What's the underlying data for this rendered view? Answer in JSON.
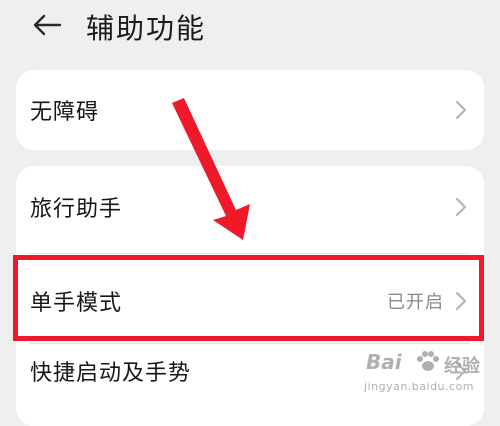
{
  "header": {
    "title": "辅助功能"
  },
  "menu": {
    "items": [
      {
        "label": "无障碍",
        "value": ""
      },
      {
        "label": "旅行助手",
        "value": ""
      },
      {
        "label": "单手模式",
        "value": "已开启"
      },
      {
        "label": "快捷启动及手势",
        "value": ""
      }
    ]
  },
  "watermark": {
    "brand": "Bai",
    "cn": "经验",
    "url": "jingyan.baidu.com"
  },
  "icons": {
    "back": "arrow-left-icon",
    "chevron": "chevron-right-icon",
    "pointer": "red-arrow-annotation-icon"
  },
  "colors": {
    "annotation": "#f0192a",
    "background": "#efefef",
    "card": "#ffffff"
  }
}
